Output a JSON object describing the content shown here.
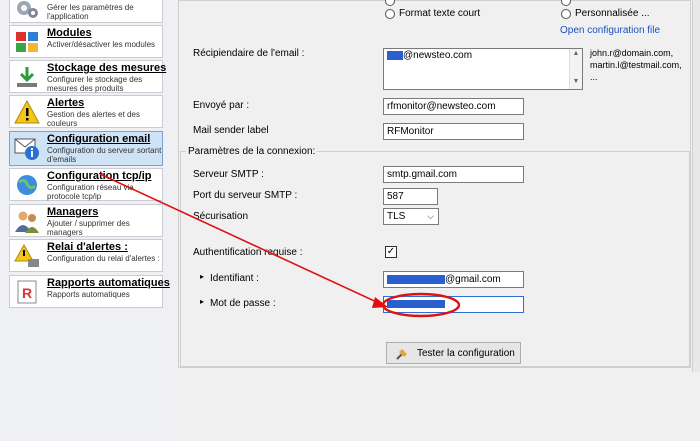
{
  "nav": {
    "items": [
      {
        "title": "",
        "desc": "Gérer les paramètres de l'application"
      },
      {
        "title": "Modules",
        "desc": "Activer/désactiver les modules"
      },
      {
        "title": "Stockage des mesures",
        "desc": "Configurer le stockage des mesures des produits"
      },
      {
        "title": "Alertes",
        "desc": "Gestion des alertes et des couleurs"
      },
      {
        "title": "Configuration email",
        "desc": "Configuration du serveur sortant d'emails"
      },
      {
        "title": "Configuration tcp/ip",
        "desc": "Configuration réseau via protocole tcp/ip"
      },
      {
        "title": "Managers",
        "desc": "Ajouter / supprimer des managers"
      },
      {
        "title": "Relai d'alertes :",
        "desc": "Configuration du relai d'alertes :"
      },
      {
        "title": "Rapports automatiques",
        "desc": "Rapports automatiques"
      }
    ]
  },
  "format": {
    "option_short": "Format texte court",
    "option_custom": "Personnalisée ...",
    "open_config": "Open configuration file"
  },
  "form": {
    "recipient_label": "Récipiendaire de l'email :",
    "recipient_value": "@newsteo.com",
    "recipient_hint": [
      "john.r@domain.com,",
      "martin.l@testmail.com,",
      "..."
    ],
    "sent_by_label": "Envoyé par :",
    "sent_by_value": "rfmonitor@newsteo.com",
    "sender_label_label": "Mail sender label",
    "sender_label_value": "RFMonitor"
  },
  "connection": {
    "group_title": "Paramètres de la connexion:",
    "smtp_label": "Serveur SMTP :",
    "smtp_value": "smtp.gmail.com",
    "port_label": "Port du serveur SMTP :",
    "port_value": "587",
    "security_label": "Sécurisation",
    "security_value": "TLS",
    "auth_label": "Authentification requise :",
    "auth_checked": "✓",
    "id_label": "Identifiant :",
    "id_value": "@gmail.com",
    "pwd_label": "Mot de passe :",
    "test_button": "Tester la configuration"
  },
  "colors": {
    "accent": "#2a5fcf",
    "annotation": "#e01010",
    "selected_bg": "#cfe3f7"
  }
}
